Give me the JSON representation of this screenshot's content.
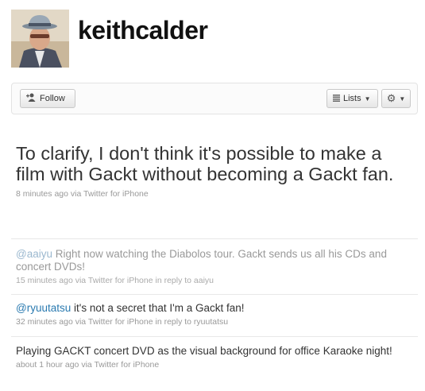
{
  "profile": {
    "username": "keithcalder"
  },
  "actions": {
    "follow_label": "Follow",
    "lists_label": "Lists",
    "follow_icon": "add-user-icon",
    "lists_icon": "list-icon",
    "settings_icon": "gear-icon"
  },
  "main_tweet": {
    "text": "To clarify, I don't think it's possible to make a film with Gackt without becoming a Gackt fan.",
    "meta": "8 minutes ago via Twitter for iPhone"
  },
  "tweets": [
    {
      "mention": "@aaiyu",
      "text": " Right now watching the Diabolos tour. Gackt sends us all his CDs and concert DVDs!",
      "meta": "15 minutes ago via Twitter for iPhone in reply to aaiyu"
    },
    {
      "mention": "@ryuutatsu",
      "text": " it's not a secret that I'm a Gackt fan!",
      "meta": "32 minutes ago via Twitter for iPhone in reply to ryuutatsu"
    },
    {
      "mention": "",
      "text": "Playing GACKT concert DVD as the visual background for office Karaoke night!",
      "meta": "about 1 hour ago via Twitter for iPhone"
    }
  ],
  "colors": {
    "link": "#2a7ab0",
    "meta": "#999999",
    "text": "#333333"
  }
}
